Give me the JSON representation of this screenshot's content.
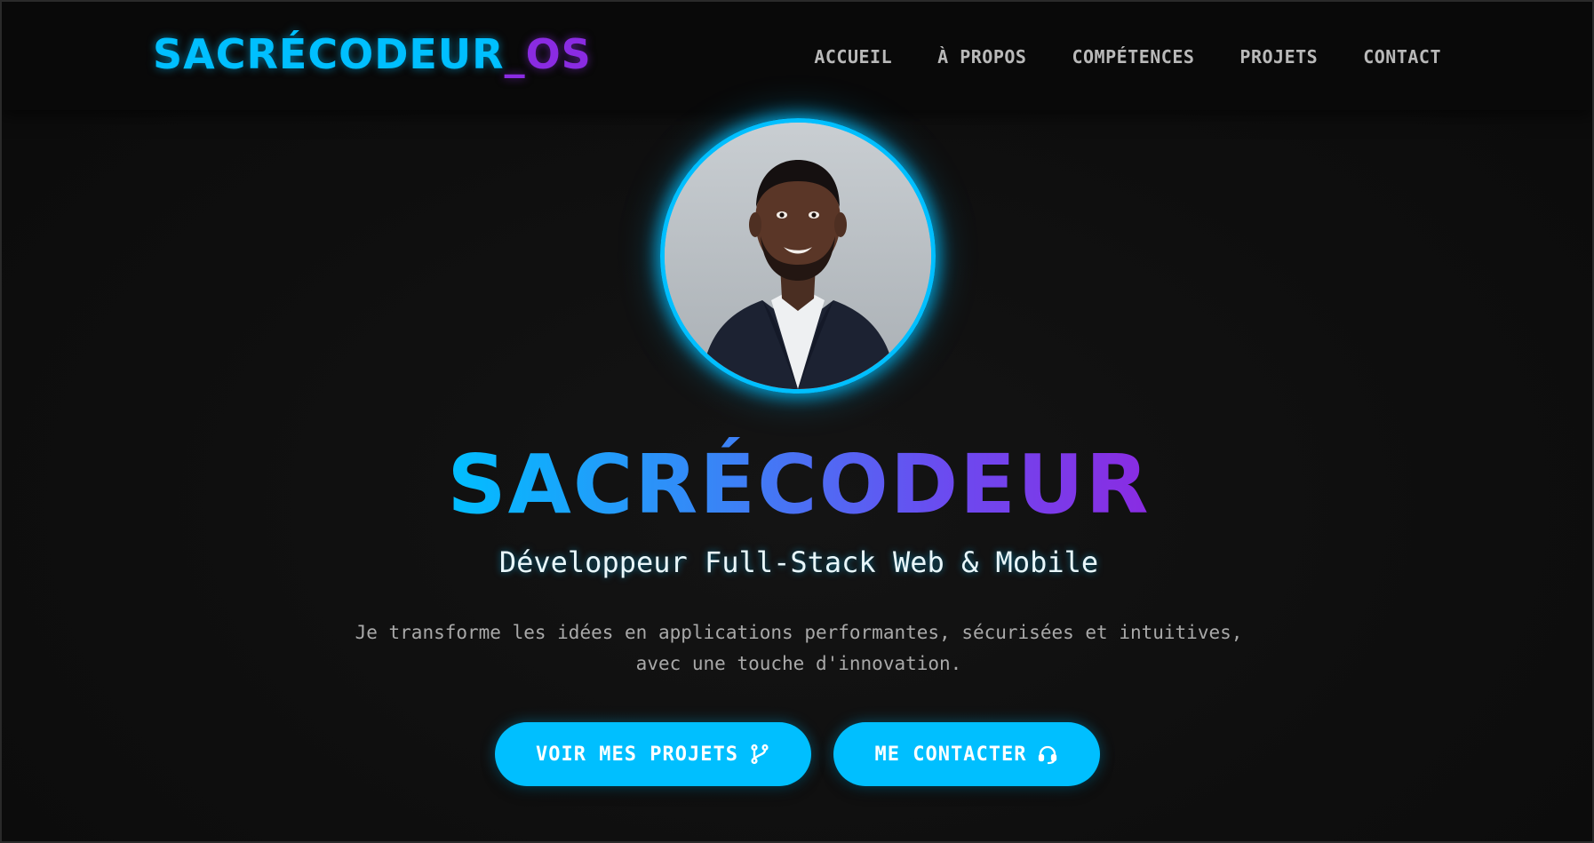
{
  "nav": {
    "logo_main": "SACRÉCODEUR",
    "logo_suffix": "_OS",
    "links": [
      "ACCUEIL",
      "À PROPOS",
      "COMPÉTENCES",
      "PROJETS",
      "CONTACT"
    ]
  },
  "hero": {
    "name": "SACRÉCODEUR",
    "subtitle": "Développeur Full-Stack Web & Mobile",
    "description": "Je transforme les idées en applications performantes, sécurisées et intuitives, avec une touche d'innovation.",
    "buttons": {
      "projects": {
        "label": "VOIR MES PROJETS",
        "icon": "git-branch-icon"
      },
      "contact": {
        "label": "ME CONTACTER",
        "icon": "headset-icon"
      }
    }
  },
  "colors": {
    "accent": "#00bfff",
    "accent_secondary": "#8a2be2",
    "background": "#0f0f0f",
    "navbar": "#090909"
  }
}
